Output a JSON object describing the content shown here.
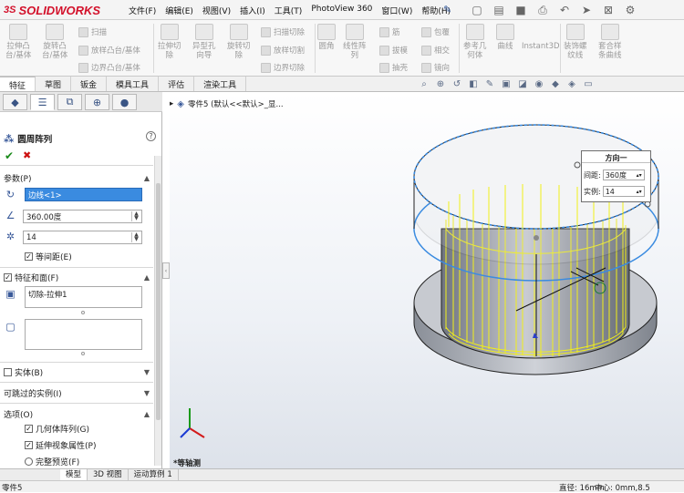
{
  "app": {
    "logo_ds": "3S",
    "logo_text": "SOLIDWORKS"
  },
  "menu": [
    "文件(F)",
    "编辑(E)",
    "视图(V)",
    "插入(I)",
    "工具(T)",
    "PhotoView 360",
    "窗口(W)",
    "帮助(H)"
  ],
  "ribbon": {
    "big": [
      "拉伸凸\n台/基体",
      "旋转凸\n台/基体",
      "拉伸切\n除",
      "异型孔\n向导",
      "旋转切\n除",
      "圆角",
      "线性阵\n列",
      "参考几\n何体",
      "曲线",
      "Instant3D",
      "装饰螺\n纹线",
      "套合样\n条曲线"
    ],
    "small": [
      "扫描",
      "放样凸台/基体",
      "边界凸台/基体",
      "扫描切除",
      "放样切割",
      "边界切除",
      "筋",
      "拔模",
      "抽壳",
      "包覆",
      "相交",
      "镜向"
    ]
  },
  "tabs": [
    "特征",
    "草图",
    "钣金",
    "模具工具",
    "评估",
    "渲染工具"
  ],
  "panel": {
    "title": "圆周阵列",
    "params_header": "参数(P)",
    "edge_value": "边线<1>",
    "angle_value": "360.00度",
    "count_value": "14",
    "equal_spacing_label": "等间距(E)",
    "equal_spacing_checked": true,
    "features_header": "特征和面(F)",
    "features_checked": true,
    "feature_item": "切除-拉伸1",
    "solid_header": "实体(B)",
    "skip_header": "可跳过的实例(I)",
    "options_header": "选项(O)",
    "opt_geometry": "几何体阵列(G)",
    "opt_visual": "延伸视象属性(P)",
    "opt_preview": "完整预览(F)"
  },
  "tree": {
    "label": "零件5 (默认<<默认>_显..."
  },
  "direction_box": {
    "title": "方向一",
    "spacing_label": "间距:",
    "spacing_value": "360度",
    "count_label": "实例:",
    "count_value": "14"
  },
  "view_label": "*等轴测",
  "bottom_tabs": [
    "模型",
    "3D 视图",
    "运动算例 1"
  ],
  "status": {
    "left": "零件5",
    "diameter": "直径: 16mm",
    "center": "中心: 0mm,8.5"
  },
  "colors": {
    "accent_red": "#d3102a",
    "preview_yellow": "#f2ef18",
    "selection_blue": "#3a8be0"
  }
}
